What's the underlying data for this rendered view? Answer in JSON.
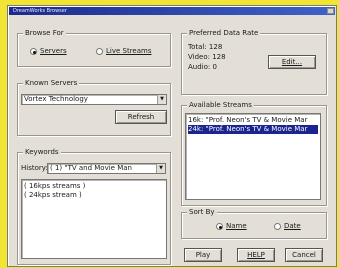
{
  "window": {
    "title": "DreamWorks Browser"
  },
  "browse_for": {
    "legend": "Browse For",
    "options": [
      "Servers",
      "Live Streams"
    ],
    "selected": "Servers"
  },
  "known_servers": {
    "legend": "Known Servers",
    "value": "Vortex Technology",
    "refresh_label": "Refresh"
  },
  "keywords": {
    "legend": "Keywords",
    "history_label": "History:",
    "history_value": "( 1) \"TV and Movie Man",
    "items": [
      "( 16kps streams )",
      "( 24kps stream )"
    ]
  },
  "preferred_rate": {
    "legend": "Preferred Data Rate",
    "total": "Total: 128",
    "video": "Video: 128",
    "audio": "Audio: 0",
    "edit_label": "Edit..."
  },
  "available_streams": {
    "legend": "Available Streams",
    "items": [
      "16k: \"Prof. Neon's TV & Movie Mar",
      "24k: \"Prof. Neon's TV & Movie Mar"
    ],
    "selected_index": 1
  },
  "sort_by": {
    "legend": "Sort By",
    "options": [
      "Name",
      "Date"
    ],
    "selected": "Name"
  },
  "buttons": {
    "play": "Play",
    "help": "HELP",
    "cancel": "Cancel"
  },
  "colors": {
    "background": "#f2e433",
    "dialog": "#e3dfd6",
    "selection": "#1b2590"
  }
}
